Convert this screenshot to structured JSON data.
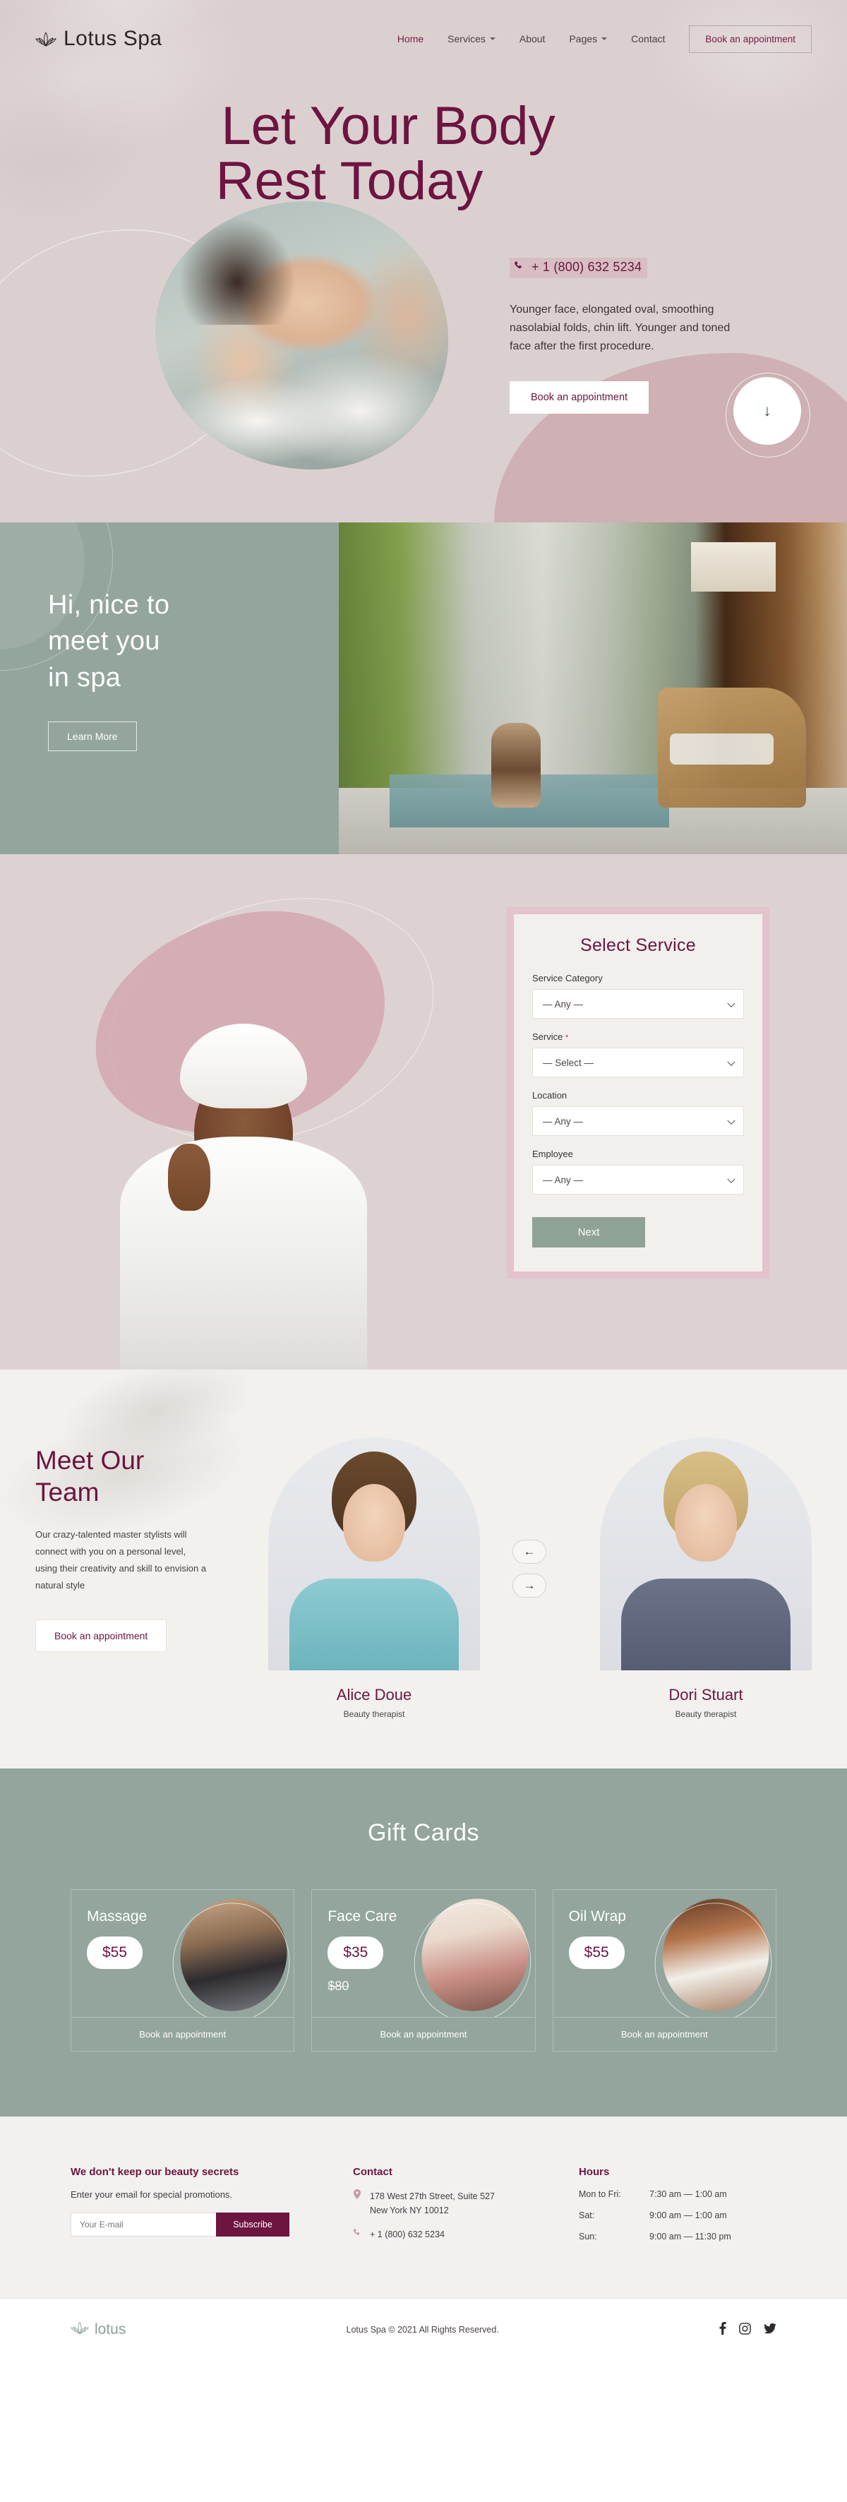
{
  "brand": {
    "name": "Lotus Spa",
    "mark_icon": "lotus-icon"
  },
  "nav": {
    "items": [
      {
        "label": "Home",
        "active": true,
        "has_dropdown": false
      },
      {
        "label": "Services",
        "active": false,
        "has_dropdown": true
      },
      {
        "label": "About",
        "active": false,
        "has_dropdown": false
      },
      {
        "label": "Pages",
        "active": false,
        "has_dropdown": true
      },
      {
        "label": "Contact",
        "active": false,
        "has_dropdown": false
      }
    ],
    "cta_label": "Book an appointment"
  },
  "hero": {
    "title_line1": "Let Your Body",
    "title_line2": "Rest Today",
    "phone": "+ 1 (800) 632 5234",
    "phone_icon": "phone-icon",
    "description": "Younger face, elongated oval, smoothing nasolabial folds, chin lift. Younger and toned face after the first procedure.",
    "cta_label": "Book an appointment",
    "scroll_icon": "arrow-down-icon"
  },
  "about": {
    "title_line1": "Hi, nice to",
    "title_line2": "meet you",
    "title_line3": "in spa",
    "cta_label": "Learn More"
  },
  "booking": {
    "title": "Select Service",
    "fields": [
      {
        "label": "Service Category",
        "required": false,
        "value": "— Any —"
      },
      {
        "label": "Service",
        "required": true,
        "value": "— Select —"
      },
      {
        "label": "Location",
        "required": false,
        "value": "— Any —"
      },
      {
        "label": "Employee",
        "required": false,
        "value": "— Any —"
      }
    ],
    "required_mark": "*",
    "next_label": "Next"
  },
  "team": {
    "title_line1": "Meet Our",
    "title_line2": "Team",
    "description": "Our crazy-talented master stylists will connect with you on a personal level, using their creativity and skill to envision a natural style",
    "cta_label": "Book an appointment",
    "prev_icon": "arrow-left-icon",
    "next_icon": "arrow-right-icon",
    "members": [
      {
        "name": "Alice Doue",
        "role": "Beauty therapist"
      },
      {
        "name": "Dori Stuart",
        "role": "Beauty therapist"
      }
    ]
  },
  "gift": {
    "title": "Gift Cards",
    "cards": [
      {
        "name": "Massage",
        "price": "$55",
        "old_price": "",
        "cta_label": "Book an appointment"
      },
      {
        "name": "Face Care",
        "price": "$35",
        "old_price": "$80",
        "cta_label": "Book an appointment"
      },
      {
        "name": "Oil Wrap",
        "price": "$55",
        "old_price": "",
        "cta_label": "Book an appointment"
      }
    ]
  },
  "footer": {
    "newsletter": {
      "heading": "We don't keep our beauty secrets",
      "subtext": "Enter your email for special promotions.",
      "placeholder": "Your E-mail",
      "button_label": "Subscribe"
    },
    "contact": {
      "heading": "Contact",
      "address_line1": "178 West 27th Street, Suite 527",
      "address_line2": "New York NY 10012",
      "phone": "+ 1 (800) 632 5234",
      "pin_icon": "map-pin-icon",
      "phone_icon": "phone-icon"
    },
    "hours": {
      "heading": "Hours",
      "rows": [
        {
          "day": "Mon to Fri:",
          "time": "7:30 am — 1:00 am"
        },
        {
          "day": "Sat:",
          "time": "9:00 am — 1:00 am"
        },
        {
          "day": "Sun:",
          "time": "9:00 am — 11:30 pm"
        }
      ]
    },
    "bottom": {
      "brand": "lotus",
      "brand_icon": "lotus-icon",
      "copyright": "Lotus Spa © 2021 All Rights Reserved.",
      "social": [
        {
          "icon": "facebook-icon",
          "glyph": "f"
        },
        {
          "icon": "instagram-icon",
          "glyph": "◙"
        },
        {
          "icon": "twitter-icon",
          "glyph": "🐦"
        }
      ]
    }
  },
  "colors": {
    "plum": "#6d1440",
    "sage": "#93a59c",
    "blush": "#ddd2d2",
    "pink": "#d3a7b0"
  }
}
